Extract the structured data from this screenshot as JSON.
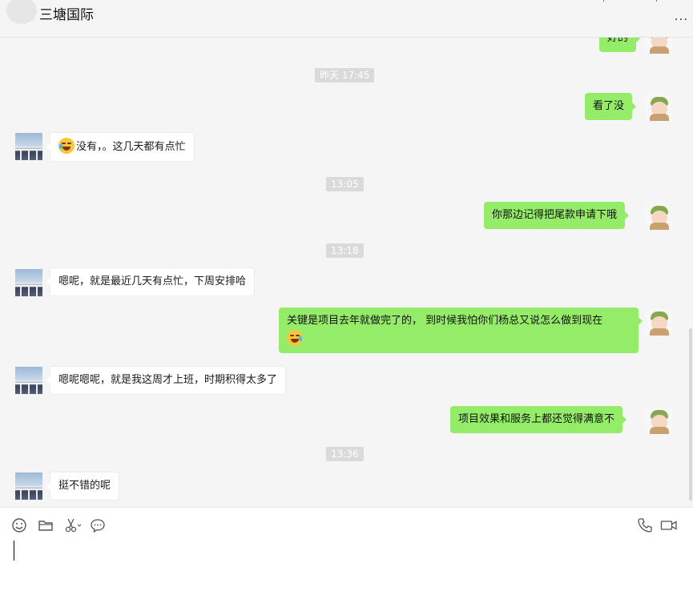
{
  "header": {
    "title": "三塘国际",
    "more_label": "..."
  },
  "messages": {
    "m1": {
      "text": "好的"
    },
    "t1": {
      "text": "昨天 17:45"
    },
    "m2": {
      "text": "看了没"
    },
    "m3": {
      "text": "没有，。这几天都有点忙",
      "emoji": "grinning-sweat-emoji"
    },
    "t2": {
      "text": "13:05"
    },
    "m4": {
      "text": "你那边记得把尾款申请下哦"
    },
    "t3": {
      "text": "13:18"
    },
    "m5": {
      "text": "嗯呢，就是最近几天有点忙，下周安排哈"
    },
    "m6": {
      "text": "关键是项目去年就做完了的， 到时候我怕你们杨总又说怎么做到现在",
      "emoji": "rolling-laughing-emoji"
    },
    "m7": {
      "text": "嗯呢嗯呢，就是我这周才上班，时期积得太多了"
    },
    "m8": {
      "text": "项目效果和服务上都还觉得满意不"
    },
    "t4": {
      "text": "13:36"
    },
    "m9": {
      "text": "挺不错的呢"
    }
  },
  "toolbar": {
    "icons": [
      "emoji-icon",
      "folder-icon",
      "scissors-icon",
      "chat-history-icon",
      "phone-icon",
      "video-call-icon"
    ]
  },
  "colors": {
    "self_bubble": "#95ec69",
    "other_bubble": "#ffffff",
    "background": "#f5f5f5",
    "timestamp_bg": "#dadada"
  }
}
